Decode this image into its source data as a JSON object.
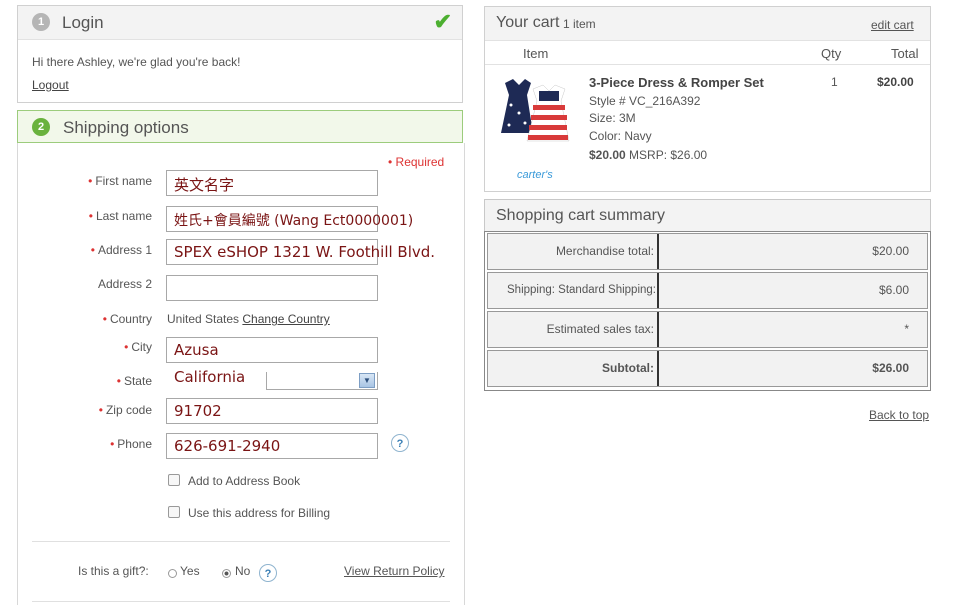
{
  "login": {
    "step": "1",
    "title": "Login",
    "greeting": "Hi there Ashley, we're glad you're back!",
    "logout": "Logout",
    "check": "✔"
  },
  "shipping": {
    "step": "2",
    "title": "Shipping options",
    "required_note": "• Required",
    "fields": {
      "first_name": {
        "label": "First name",
        "value": "英文名字"
      },
      "last_name": {
        "label": "Last name",
        "value": "姓氏+會員編號 (Wang Ect0000001)"
      },
      "address1": {
        "label": "Address 1",
        "value": "SPEX eSHOP 1321 W. Foothill Blvd."
      },
      "address2": {
        "label": "Address 2",
        "value": ""
      },
      "country": {
        "label": "Country",
        "value": "United States",
        "change": "Change Country"
      },
      "city": {
        "label": "City",
        "value": "Azusa"
      },
      "state": {
        "label": "State",
        "value": "California"
      },
      "zip": {
        "label": "Zip code",
        "value": "91702"
      },
      "phone": {
        "label": "Phone",
        "value": "626-691-2940"
      }
    },
    "req_mark": "•",
    "add_address_book": "Add to Address Book",
    "use_for_billing": "Use this address for Billing",
    "gift_label": "Is this a gift?:",
    "gift_yes": "Yes",
    "gift_no": "No",
    "return_policy": "View Return Policy",
    "help": "?"
  },
  "cart": {
    "title": "Your cart",
    "count": "1 item",
    "edit": "edit cart",
    "col_item": "Item",
    "col_qty": "Qty",
    "col_total": "Total",
    "product": {
      "name": "3-Piece Dress & Romper Set",
      "style": "Style # VC_216A392",
      "size": "Size: 3M",
      "color": "Color: Navy",
      "price": "$20.00",
      "msrp": "MSRP: $26.00",
      "qty": "1",
      "total": "$20.00",
      "brand": "carter's"
    }
  },
  "summary": {
    "title": "Shopping cart summary",
    "rows": [
      {
        "label": "Merchandise total:",
        "value": "$20.00"
      },
      {
        "label": "Shipping: Standard Shipping:",
        "value": "$6.00"
      },
      {
        "label": "Estimated sales tax:",
        "value": "*"
      },
      {
        "label": "Subtotal:",
        "value": "$26.00"
      }
    ],
    "back_to_top": "Back to top"
  },
  "colors": {
    "accent_green": "#6ab23e",
    "required_red": "#d33333",
    "value_text": "#7a1414"
  }
}
